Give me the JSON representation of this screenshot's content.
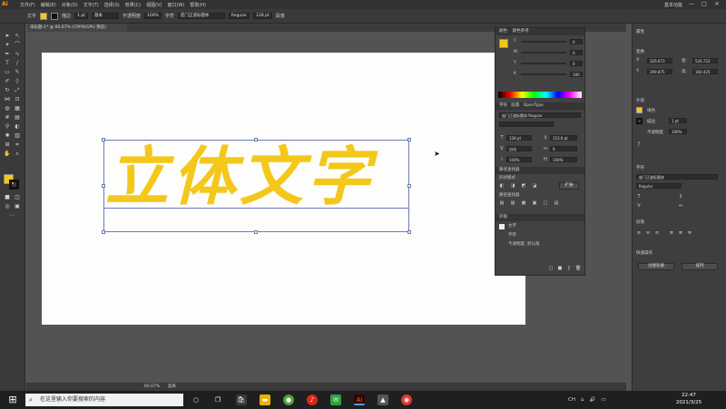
{
  "app": {
    "logo": "Ai",
    "menu": [
      "文件(F)",
      "编辑(E)",
      "对象(O)",
      "文字(T)",
      "选择(S)",
      "效果(C)",
      "视图(V)",
      "窗口(W)",
      "帮助(H)"
    ],
    "workspace": "基本功能",
    "window_controls": [
      "—",
      "□",
      "✕"
    ]
  },
  "controlbar": {
    "section": "文字",
    "fill_color": "#f4c81a",
    "stroke_label": "描边",
    "stroke_value": "1 pt",
    "brush_label": "基本",
    "opacity_label": "不透明度",
    "opacity_value": "100%",
    "char_label": "字符",
    "font_name": "庞门正道标题体",
    "font_style": "Regular",
    "font_size": "128 pt",
    "para_label": "段落"
  },
  "document": {
    "tab_title": "未标题-1* @ 66.67% (CMYK/GPU 预览)",
    "zoom": "66.67%",
    "status_tool": "选择"
  },
  "artwork": {
    "text": "立体文字",
    "color": "#f4c81a"
  },
  "floatpanel": {
    "color_tab": "颜色",
    "color_guide_tab": "颜色参考",
    "channels": [
      {
        "label": "C",
        "value": "0"
      },
      {
        "label": "M",
        "value": "0"
      },
      {
        "label": "Y",
        "value": "0"
      },
      {
        "label": "K",
        "value": "100"
      }
    ],
    "char_tab": "字符",
    "para_tab": "段落",
    "opentype_tab": "OpenType",
    "font": "庞门正道标题体 Regular",
    "size_field": "128 pt",
    "leading_field": "153.6 pt",
    "scale_field": "100%",
    "track_field": "0",
    "kern_field": "自动",
    "pathfinder_tab": "路径查找器",
    "shape_mode_label": "形状模式",
    "pathfinder_label": "路径查找器",
    "expand_label": "扩展",
    "appearance_tab": "外观",
    "appearance_items": [
      "文字",
      "字符",
      "不透明度: 默认值"
    ]
  },
  "rightdock": {
    "properties_title": "属性",
    "transform_title": "变换",
    "x_label": "X:",
    "x_value": "326.673",
    "y_label": "Y:",
    "y_value": "299.875",
    "w_label": "宽:",
    "w_value": "526.723",
    "h_label": "高:",
    "h_value": "160.425",
    "appearance_title": "外观",
    "fill_label": "填色",
    "stroke_label": "描边",
    "stroke_value": "1 pt",
    "opacity_label": "不透明度",
    "opacity_value": "100%",
    "char_title": "字符",
    "font": "庞门正道标题体",
    "style": "Regular",
    "para_title": "段落",
    "quick_actions_title": "快速操作",
    "btn_outline": "创建轮廓",
    "btn_arrange": "排列"
  },
  "taskbar": {
    "search_placeholder": "在这里输入你要搜索的内容",
    "tray_items": [
      "CH",
      "🔊"
    ],
    "time": "22:47",
    "date": "2021/3/25"
  }
}
